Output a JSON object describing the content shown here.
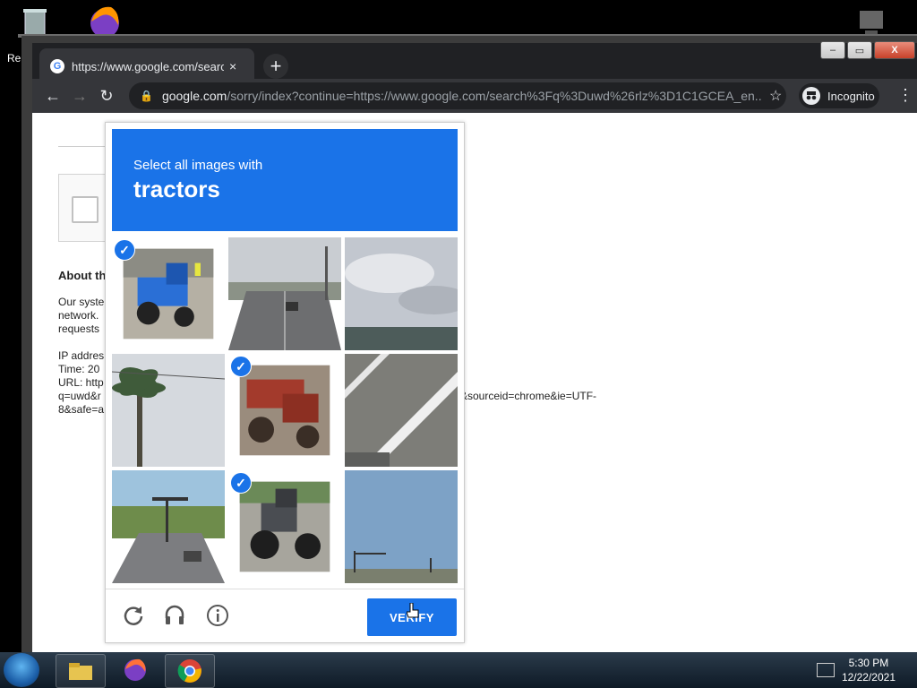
{
  "desktop": {
    "icons": [
      "recycle-bin-icon",
      "firefox-icon",
      "computer-icon"
    ],
    "partial_label": "Re"
  },
  "browser": {
    "tab_title": "https://www.google.com/search?",
    "tab_close": "×",
    "new_tab": "+",
    "url_host": "google.com",
    "url_rest": "/sorry/index?continue=https://www.google.com/search%3Fq%3Duwd%26rlz%3D1C1GCEA_en...",
    "incognito_label": "Incognito",
    "window_controls": {
      "minimize": "–",
      "maximize": "▭",
      "close": "X"
    }
  },
  "page": {
    "about_heading": "About th",
    "para1": "Our syste\nnetwork.\nrequests",
    "para2": "IP addres\nTime: 20\nURL: http\nq=uwd&r\n8&safe=a",
    "url_tail": "&sourceid=chrome&ie=UTF-\n"
  },
  "captcha": {
    "prompt_line1": "Select all images with",
    "prompt_line2": "tractors",
    "tiles": [
      {
        "scene": "blue-tractor",
        "selected": true
      },
      {
        "scene": "road",
        "selected": false
      },
      {
        "scene": "sky-town",
        "selected": false
      },
      {
        "scene": "palm-tree",
        "selected": false
      },
      {
        "scene": "red-tractor",
        "selected": true
      },
      {
        "scene": "road-stripe",
        "selected": false
      },
      {
        "scene": "street-intersection",
        "selected": false
      },
      {
        "scene": "gray-tractor",
        "selected": true
      },
      {
        "scene": "sky-traffic-light",
        "selected": false
      }
    ],
    "verify_label": "VERIFY",
    "colors": {
      "accent": "#1a73e8"
    }
  },
  "taskbar": {
    "time": "5:30 PM",
    "date": "12/22/2021",
    "apps": [
      "file-explorer-icon",
      "firefox-icon",
      "chrome-icon"
    ]
  }
}
